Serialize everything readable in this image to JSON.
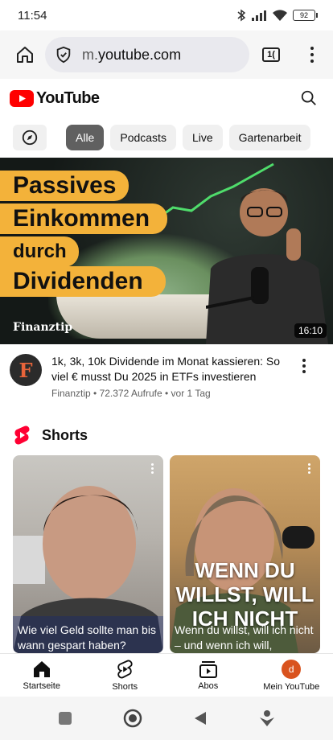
{
  "status_bar": {
    "time": "11:54",
    "battery": "92"
  },
  "browser": {
    "url_prefix": "m.",
    "url_domain": "youtube.com",
    "tab_count": "1("
  },
  "youtube": {
    "logo_text": "YouTube"
  },
  "chips": [
    "Alle",
    "Podcasts",
    "Live",
    "Gartenarbeit"
  ],
  "featured_video": {
    "thumbnail_lines": [
      "Passives",
      "Einkommen",
      "durch",
      "Dividenden"
    ],
    "thumbnail_brand": "Finanztip",
    "duration": "16:10",
    "channel_initial": "F",
    "title": "1k, 3k, 10k Dividende im Monat kassieren: So viel € musst Du 2025 in ETFs investieren",
    "channel": "Finanztip",
    "views": "72.372 Aufrufe",
    "age": "vor 1 Tag"
  },
  "shorts": {
    "title": "Shorts",
    "items": [
      {
        "caption": "Wie viel Geld sollte man bis wann gespart haben?"
      },
      {
        "overlay": "WENN DU WILLST, WILL ICH NICHT",
        "caption": "Wenn du willst, will ich nicht – und wenn ich will,"
      }
    ]
  },
  "bottom_nav": [
    {
      "label": "Startseite",
      "icon": "home-icon"
    },
    {
      "label": "Shorts",
      "icon": "shorts-icon"
    },
    {
      "label": "Abos",
      "icon": "subscriptions-icon"
    },
    {
      "label": "Mein YouTube",
      "icon": "avatar",
      "avatar_letter": "d"
    }
  ],
  "colors": {
    "brand_red": "#ff0000",
    "thumbnail_accent": "#f3b23a",
    "avatar_orange": "#d9531e"
  }
}
